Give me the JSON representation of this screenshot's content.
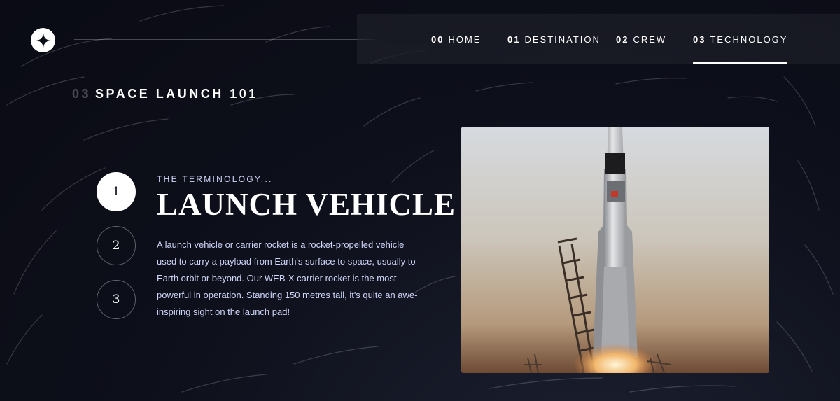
{
  "nav": {
    "items": [
      {
        "num": "00",
        "label": "HOME"
      },
      {
        "num": "01",
        "label": "DESTINATION"
      },
      {
        "num": "02",
        "label": "CREW"
      },
      {
        "num": "03",
        "label": "TECHNOLOGY"
      }
    ],
    "active_index": 3
  },
  "page": {
    "heading_num": "03",
    "heading_text": "SPACE LAUNCH 101"
  },
  "steps": {
    "items": [
      "1",
      "2",
      "3"
    ],
    "active_index": 0
  },
  "technology": {
    "eyebrow": "THE TERMINOLOGY...",
    "name": "LAUNCH VEHICLE",
    "description": "A launch vehicle or carrier rocket is a rocket-propelled vehicle used to carry a payload from Earth's surface to space, usually to Earth orbit or beyond. Our WEB-X carrier rocket is the most powerful in operation. Standing 150 metres tall, it's quite an awe-inspiring sight on the launch pad!"
  },
  "colors": {
    "background": "#0b0d17",
    "accent_text": "#d0d6f9",
    "white": "#ffffff"
  },
  "icons": {
    "logo": "four-point-star-icon"
  }
}
